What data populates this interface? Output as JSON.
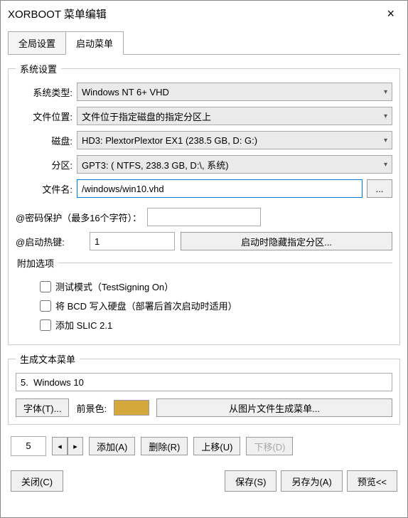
{
  "window": {
    "title": "XORBOOT 菜单编辑",
    "close_label": "×"
  },
  "tabs": {
    "global": "全局设置",
    "boot": "启动菜单"
  },
  "system_settings": {
    "legend": "系统设置",
    "type_label": "系统类型:",
    "type_value": "Windows NT 6+ VHD",
    "loc_label": "文件位置:",
    "loc_value": "文件位于指定磁盘的指定分区上",
    "disk_label": "磁盘:",
    "disk_value": "HD3: PlextorPlextor EX1 (238.5 GB, D: G:)",
    "part_label": "分区:",
    "part_value": "GPT3: ( NTFS, 238.3 GB, D:\\, 系统)",
    "file_label": "文件名:",
    "file_value": "/windows/win10.vhd",
    "browse_label": "...",
    "pw_label": "@密码保护（最多16个字符）：",
    "hotkey_label": "@启动热键:",
    "hotkey_value": "1",
    "hide_btn": "启动时隐藏指定分区..."
  },
  "additional": {
    "legend": "附加选项",
    "test_mode": "测试模式（TestSigning On）",
    "write_bcd": "将 BCD 写入硬盘（部署后首次启动时适用）",
    "add_slic": "添加 SLIC 2.1"
  },
  "text_menu": {
    "legend": "生成文本菜单",
    "entry_value": "5.  Windows 10",
    "font_btn": "字体(T)...",
    "fg_label": "前景色:",
    "fg_color": "#d4a83c",
    "gen_from_img_btn": "从图片文件生成菜单..."
  },
  "nav": {
    "current": "5",
    "prev": "◂",
    "next": "▸",
    "add_btn": "添加(A)",
    "del_btn": "删除(R)",
    "up_btn": "上移(U)",
    "down_btn": "下移(D)"
  },
  "footer": {
    "close_btn": "关闭(C)",
    "save_btn": "保存(S)",
    "save_as_btn": "另存为(A)",
    "preview_btn": "预览<<"
  }
}
